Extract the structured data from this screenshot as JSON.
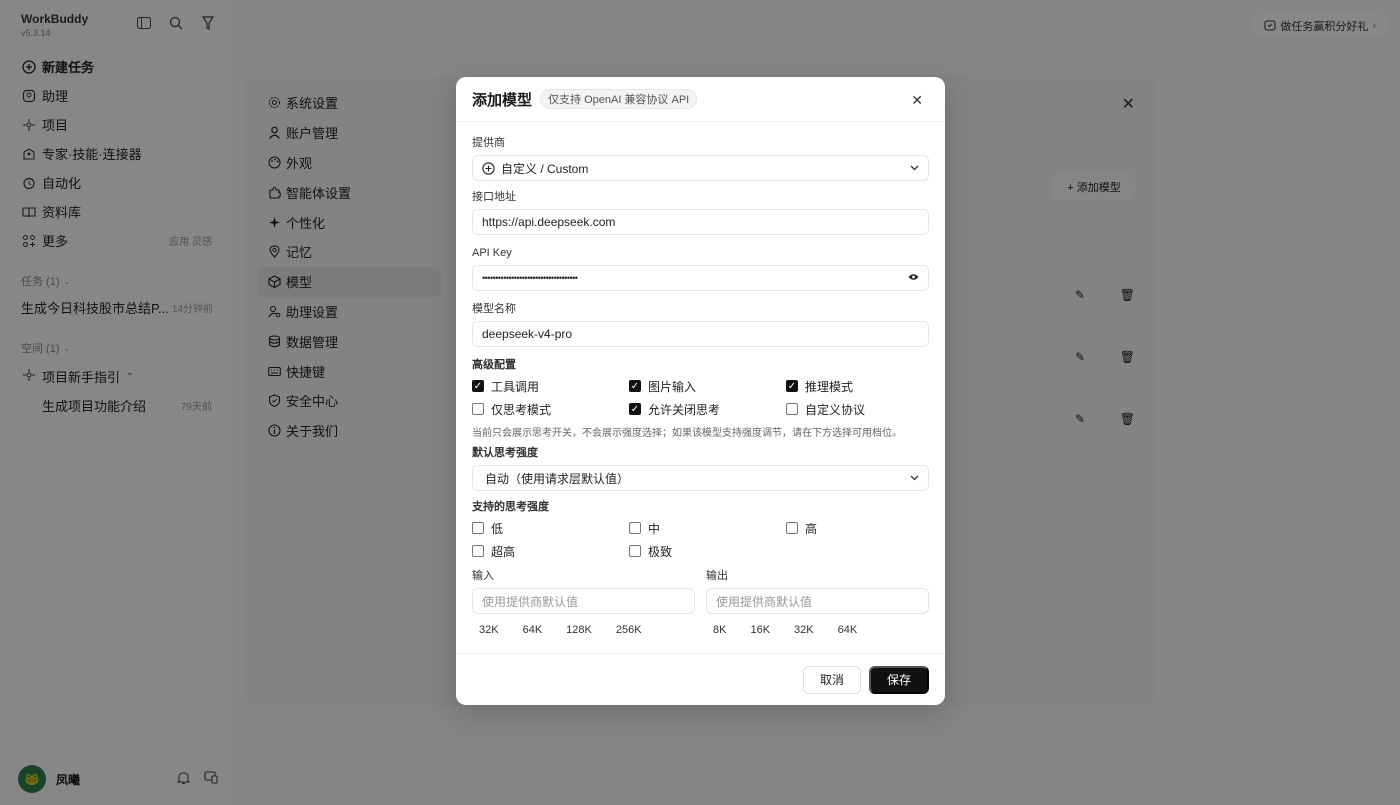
{
  "app": {
    "name": "WorkBuddy",
    "version": "v5.3.14"
  },
  "nav": [
    {
      "label": "新建任务",
      "icon": "plus-circle-icon",
      "meta": ""
    },
    {
      "label": "助理",
      "icon": "assistant-icon",
      "meta": ""
    },
    {
      "label": "项目",
      "icon": "project-icon",
      "meta": ""
    },
    {
      "label": "专家·技能·连接器",
      "icon": "expert-icon",
      "meta": ""
    },
    {
      "label": "自动化",
      "icon": "clock-icon",
      "meta": ""
    },
    {
      "label": "资料库",
      "icon": "book-icon",
      "meta": ""
    },
    {
      "label": "更多",
      "icon": "grid-icon",
      "meta": "应用 灵感"
    }
  ],
  "tasks": {
    "title": "任务 (1)",
    "items": [
      {
        "label": "生成今日科技股市总结P...",
        "time": "14分钟前"
      }
    ]
  },
  "space": {
    "title": "空间 (1)",
    "project": "项目新手指引",
    "items": [
      {
        "label": "生成项目功能介绍",
        "time": "79天前"
      }
    ]
  },
  "user": {
    "name": "凤曦"
  },
  "promo": {
    "label": "做任务赢积分好礼"
  },
  "settings": {
    "nav": [
      {
        "label": "系统设置",
        "icon": "gear-icon"
      },
      {
        "label": "账户管理",
        "icon": "user-icon"
      },
      {
        "label": "外观",
        "icon": "palette-icon"
      },
      {
        "label": "智能体设置",
        "icon": "puzzle-icon"
      },
      {
        "label": "个性化",
        "icon": "sparkle-icon"
      },
      {
        "label": "记忆",
        "icon": "location-icon"
      },
      {
        "label": "模型",
        "icon": "cube-icon"
      },
      {
        "label": "助理设置",
        "icon": "user-settings-icon"
      },
      {
        "label": "数据管理",
        "icon": "database-icon"
      },
      {
        "label": "快捷键",
        "icon": "keyboard-icon"
      },
      {
        "label": "安全中心",
        "icon": "shield-icon"
      },
      {
        "label": "关于我们",
        "icon": "info-icon"
      }
    ],
    "active": "模型",
    "add_model": "+ 添加模型"
  },
  "modal": {
    "title": "添加模型",
    "tag": "仅支持 OpenAI 兼容协议 API",
    "provider_label": "提供商",
    "provider_value": "自定义 / Custom",
    "endpoint_label": "接口地址",
    "endpoint_value": "https://api.deepseek.com",
    "apikey_label": "API Key",
    "apikey_value": "••••••••••••••••••••••••••••••••••••",
    "model_name_label": "模型名称",
    "model_name_value": "deepseek-v4-pro",
    "advanced_label": "高级配置",
    "advanced": [
      {
        "label": "工具调用",
        "checked": true
      },
      {
        "label": "图片输入",
        "checked": true
      },
      {
        "label": "推理模式",
        "checked": true
      },
      {
        "label": "仅思考模式",
        "checked": false
      },
      {
        "label": "允许关闭思考",
        "checked": true
      },
      {
        "label": "自定义协议",
        "checked": false
      }
    ],
    "hint": "当前只会展示思考开关，不会展示强度选择；如果该模型支持强度调节，请在下方选择可用档位。",
    "default_strength_label": "默认思考强度",
    "default_strength_value": "自动（使用请求层默认值）",
    "supported_strength_label": "支持的思考强度",
    "strengths": [
      {
        "label": "低",
        "checked": false
      },
      {
        "label": "中",
        "checked": false
      },
      {
        "label": "高",
        "checked": false
      },
      {
        "label": "超高",
        "checked": false
      },
      {
        "label": "极致",
        "checked": false
      }
    ],
    "input_label": "输入",
    "input_placeholder": "使用提供商默认值",
    "input_presets": [
      "32K",
      "64K",
      "128K",
      "256K"
    ],
    "output_label": "输出",
    "output_placeholder": "使用提供商默认值",
    "output_presets": [
      "8K",
      "16K",
      "32K",
      "64K"
    ],
    "cancel": "取消",
    "save": "保存"
  }
}
